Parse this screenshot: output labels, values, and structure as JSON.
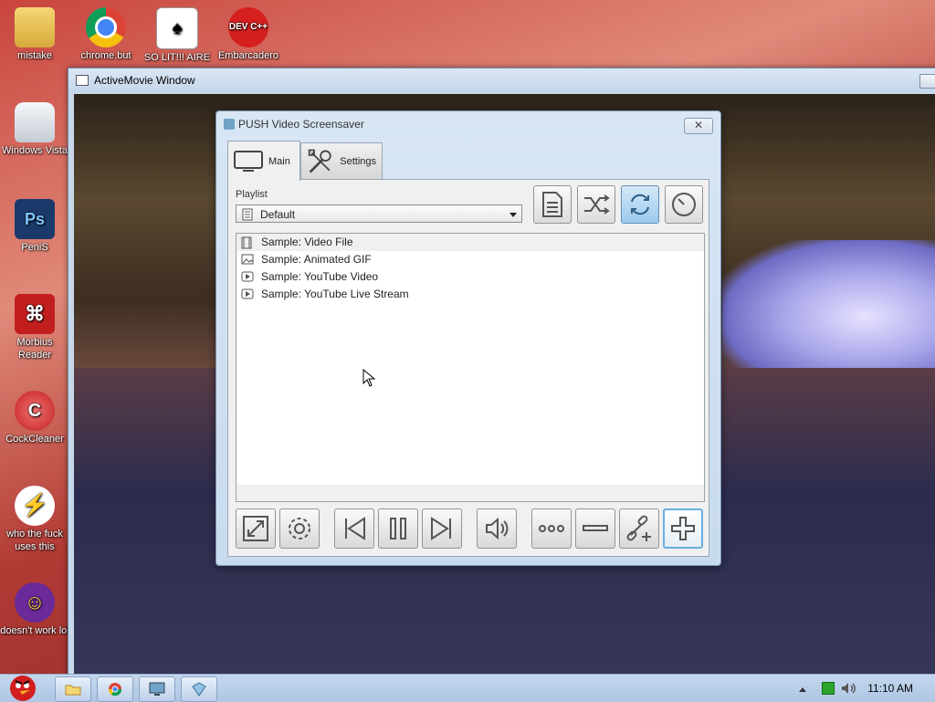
{
  "desktop": {
    "icons": [
      {
        "label": "mistake"
      },
      {
        "label": "chrome.but"
      },
      {
        "label": "SO LIT!!! AIRE"
      },
      {
        "label": "Embarcadero"
      },
      {
        "label": "Windows Vista"
      },
      {
        "label": "PeniS"
      },
      {
        "label": "Morbius Reader"
      },
      {
        "label": "CockCleaner"
      },
      {
        "label": "who the fuck uses this"
      },
      {
        "label": "doesn't work lol"
      }
    ],
    "dev_badge": "DEV C++",
    "ps_badge": "Ps"
  },
  "activemovie": {
    "title": "ActiveMovie Window"
  },
  "dialog": {
    "title": "PUSH Video Screensaver",
    "close_label": "✕",
    "tabs": [
      {
        "label": "Main",
        "active": true
      },
      {
        "label": "Settings",
        "active": false
      }
    ],
    "playlist_label": "Playlist",
    "playlist_selected": "Default",
    "items": [
      {
        "label": "Sample: Video File",
        "icon": "film-icon"
      },
      {
        "label": "Sample: Animated GIF",
        "icon": "image-icon"
      },
      {
        "label": "Sample: YouTube Video",
        "icon": "play-icon"
      },
      {
        "label": "Sample: YouTube Live Stream",
        "icon": "play-icon"
      }
    ]
  },
  "taskbar": {
    "clock": "11:10 AM"
  },
  "colors": {
    "accent": "#6aaee0",
    "toggle_on": "#9ec9ec"
  }
}
